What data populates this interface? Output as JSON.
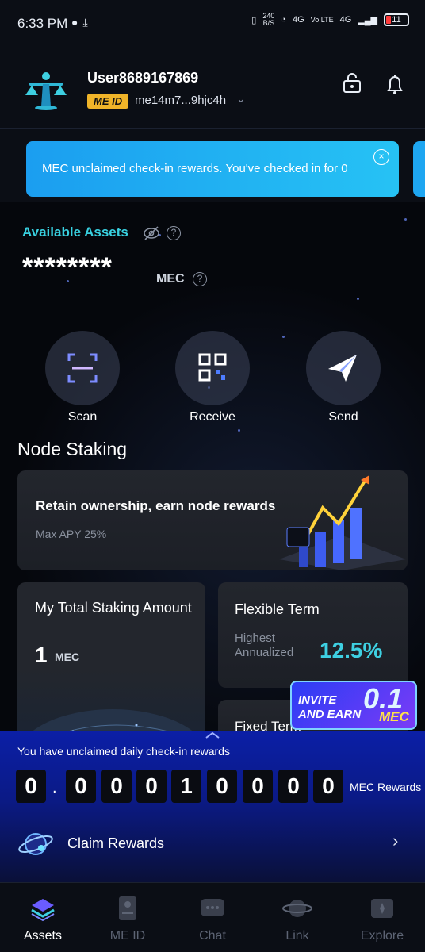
{
  "status_bar": {
    "time": "6:33 PM",
    "left_icons": [
      "chat-bubble-icon",
      "download-icon"
    ],
    "net_speed_top": "240",
    "net_speed_bottom": "B/S",
    "network_1": "4G",
    "network_2": "Vo LTE",
    "network_3": "4G",
    "battery": "11"
  },
  "header": {
    "username": "User8689167869",
    "me_id_badge": "ME ID",
    "me_id_value": "me14m7...9hjc4h"
  },
  "banner": {
    "text": "MEC unclaimed check-in rewards. You've checked in for 0",
    "close_label": "×"
  },
  "assets": {
    "label": "Available Assets",
    "balance": "********",
    "unit": "MEC"
  },
  "actions": [
    {
      "label": "Scan",
      "icon": "scan-icon"
    },
    {
      "label": "Receive",
      "icon": "qr-code-icon"
    },
    {
      "label": "Send",
      "icon": "send-icon"
    }
  ],
  "node_staking": {
    "title": "Node Staking",
    "promo_title": "Retain ownership, earn node rewards",
    "promo_sub": "Max APY 25%",
    "total_title": "My Total Staking Amount",
    "total_value": "1",
    "total_unit": "MEC",
    "flexible_title": "Flexible Term",
    "flexible_label": "Highest Annualized",
    "flexible_rate": "12.5%",
    "fixed_title": "Fixed Term"
  },
  "invite": {
    "text_line1": "INVITE",
    "text_line2": "AND EARN",
    "amount": "0.1",
    "unit": "MEC"
  },
  "rewards": {
    "message": "You have unclaimed daily check-in rewards",
    "digits": [
      "0",
      "0",
      "0",
      "0",
      "1",
      "0",
      "0",
      "0",
      "0"
    ],
    "separator": ".",
    "unit": "MEC Rewards",
    "claim_label": "Claim Rewards"
  },
  "bottom_nav": [
    {
      "label": "Assets",
      "icon": "assets-icon",
      "active": true
    },
    {
      "label": "ME ID",
      "icon": "id-card-icon",
      "active": false
    },
    {
      "label": "Chat",
      "icon": "chat-icon",
      "active": false
    },
    {
      "label": "Link",
      "icon": "planet-icon",
      "active": false
    },
    {
      "label": "Explore",
      "icon": "explore-icon",
      "active": false
    }
  ],
  "colors": {
    "accent_cyan": "#38d0e0",
    "badge_gold": "#f0b429",
    "banner_blue": "#1b9ef0",
    "reward_panel_blue": "#0b1fa6"
  }
}
